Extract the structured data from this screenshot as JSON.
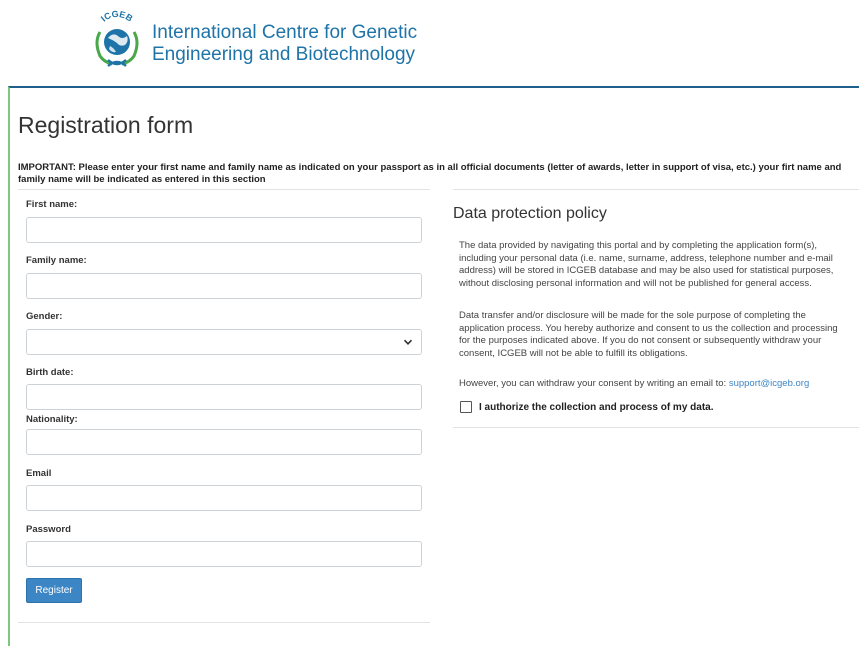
{
  "header": {
    "logo_text": "ICGEB",
    "org_name_line1": "International Centre for Genetic",
    "org_name_line2": "Engineering and Biotechnology"
  },
  "page": {
    "title": "Registration form",
    "important_line1": "IMPORTANT: Please enter your first name and family name as indicated on your passport as in all official documents (letter of awards, letter in support of visa, etc.) your firt name and",
    "important_line2": "family name will be indicated as entered in this section"
  },
  "form": {
    "first_name_label": "First name:",
    "first_name_value": "",
    "family_name_label": "Family name:",
    "family_name_value": "",
    "gender_label": "Gender:",
    "gender_value": "",
    "birth_date_label": "Birth date:",
    "birth_date_value": "",
    "nationality_label": "Nationality:",
    "nationality_value": "",
    "email_label": "Email",
    "email_value": "",
    "password_label": "Password",
    "password_value": "",
    "register_label": "Register"
  },
  "data_protection": {
    "title": "Data protection policy",
    "para1_l1": "The data provided by navigating this portal and by completing the application form(s),",
    "para1_l2": "including your personal data (i.e. name, surname, address, telephone number and e-mail",
    "para1_l3": "address) will be stored in ICGEB database and may be also used for statistical purposes,",
    "para1_l4": "without disclosing personal information and will not be published for general access.",
    "para2_l1": "Data transfer and/or disclosure will be made for the sole purpose of completing the",
    "para2_l2": "application process. You hereby authorize and consent to us the collection and processing",
    "para2_l3": "for the purposes indicated above. If you do not consent or subsequently withdraw your",
    "para2_l4": "consent, ICGEB will not be able to fulfill its obligations.",
    "para3_text": "However, you can withdraw your consent by writing an email to: ",
    "para3_link": "support@icgeb.org",
    "consent_label": "I authorize the collection and process of my data.",
    "consent_checked": false
  },
  "colors": {
    "brand_blue": "#1e74a8",
    "button_blue": "#3d86c6",
    "frame_top": "#1f5f8b",
    "frame_left": "#7ec87e"
  }
}
